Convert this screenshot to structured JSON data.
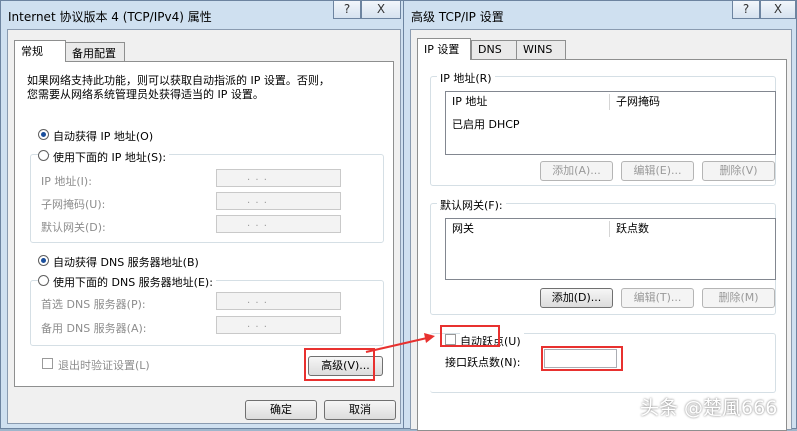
{
  "left_dialog": {
    "title": "Internet 协议版本 4 (TCP/IPv4) 属性",
    "help_btn": "?",
    "close_btn": "X",
    "tabs": [
      "常规",
      "备用配置"
    ],
    "description_line1": "如果网络支持此功能，则可以获取自动指派的 IP 设置。否则，",
    "description_line2": "您需要从网络系统管理员处获得适当的 IP 设置。",
    "auto_ip_label": "自动获得 IP 地址(O)",
    "manual_ip_label": "使用下面的 IP 地址(S):",
    "ip_address_label": "IP 地址(I):",
    "subnet_label": "子网掩码(U):",
    "gateway_label": "默认网关(D):",
    "auto_dns_label": "自动获得 DNS 服务器地址(B)",
    "manual_dns_label": "使用下面的 DNS 服务器地址(E):",
    "preferred_dns_label": "首选 DNS 服务器(P):",
    "alternate_dns_label": "备用 DNS 服务器(A):",
    "ip_placeholder_dots": ". . .",
    "validate_on_exit_label": "退出时验证设置(L)",
    "advanced_button": "高级(V)...",
    "ok_button": "确定",
    "cancel_button": "取消",
    "auto_ip_selected": true,
    "auto_dns_selected": true
  },
  "right_dialog": {
    "title": "高级 TCP/IP 设置",
    "help_btn": "?",
    "close_btn": "X",
    "tabs": [
      "IP 设置",
      "DNS",
      "WINS"
    ],
    "ip_group_label": "IP 地址(R)",
    "ip_columns": [
      "IP 地址",
      "子网掩码"
    ],
    "ip_rows": [
      "已启用 DHCP"
    ],
    "ip_add": "添加(A)...",
    "ip_edit": "编辑(E)...",
    "ip_delete": "删除(V)",
    "gw_group_label": "默认网关(F):",
    "gw_columns": [
      "网关",
      "跃点数"
    ],
    "gw_add": "添加(D)...",
    "gw_edit": "编辑(T)...",
    "gw_delete": "删除(M)",
    "auto_metric_label": "自动跃点(U)",
    "interface_metric_label": "接口跃点数(N):",
    "interface_metric_value": ""
  },
  "watermark": "头条 @楚風666",
  "colors": {
    "highlight": "#e8312f",
    "window_frame": "#cfe0f0"
  }
}
